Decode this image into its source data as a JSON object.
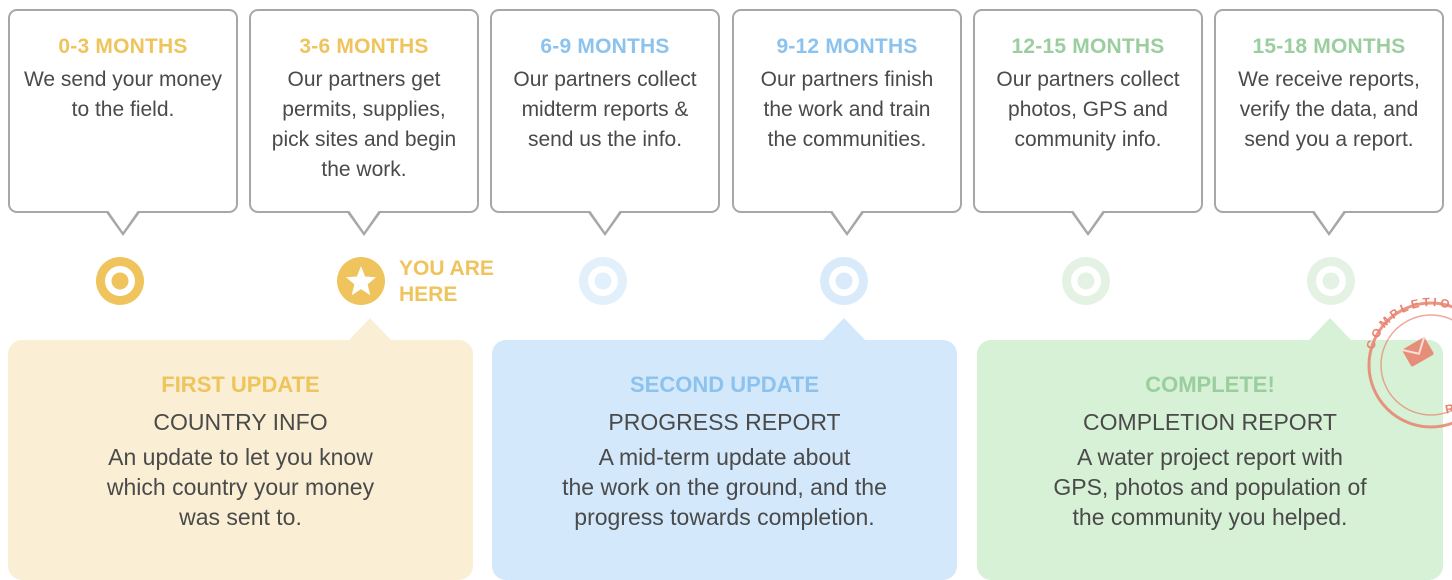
{
  "colors": {
    "yellow": "#efc45c",
    "blue": "#8cc3ee",
    "green": "#9bce9e",
    "card_border": "#a7a7a7",
    "body_text": "#4a4a4a",
    "panel_yellow": "#faefd4",
    "panel_blue": "#d3e8fb",
    "panel_green": "#d7f1d6"
  },
  "timeline": [
    {
      "period": "0-3 MONTHS",
      "description": "We send your money to the field.",
      "color": "yellow",
      "marker": "target-icon"
    },
    {
      "period": "3-6 MONTHS",
      "description": "Our partners get permits, supplies, pick sites and begin the work.",
      "color": "yellow",
      "marker": "star-icon"
    },
    {
      "period": "6-9 MONTHS",
      "description": "Our partners collect midterm reports & send us the info.",
      "color": "blue",
      "marker": "target-icon"
    },
    {
      "period": "9-12 MONTHS",
      "description": "Our partners finish the work and train the communities.",
      "color": "blue",
      "marker": "target-icon"
    },
    {
      "period": "12-15 MONTHS",
      "description": "Our partners collect photos, GPS and community info.",
      "color": "green",
      "marker": "target-icon"
    },
    {
      "period": "15-18 MONTHS",
      "description": "We receive reports, verify the data, and send you a report.",
      "color": "green",
      "marker": "target-icon"
    }
  ],
  "current_position_label_line1": "YOU ARE",
  "current_position_label_line2": "HERE",
  "updates": [
    {
      "title": "FIRST UPDATE",
      "subtitle": "COUNTRY INFO",
      "description_lines": [
        "An update to let you know",
        "which country your money",
        "was sent to."
      ]
    },
    {
      "title": "SECOND UPDATE",
      "subtitle": "PROGRESS REPORT",
      "description_lines": [
        "A mid-term update about",
        "the work on the ground, and the",
        "progress towards completion."
      ]
    },
    {
      "title": "COMPLETE!",
      "subtitle": "COMPLETION REPORT",
      "description_lines": [
        "A water project report with",
        "GPS, photos and population of",
        "the community you helped."
      ]
    }
  ],
  "stamp": {
    "text_top": "COMPLETION",
    "text_bottom": "REPORT",
    "icon": "stamp-icon"
  }
}
